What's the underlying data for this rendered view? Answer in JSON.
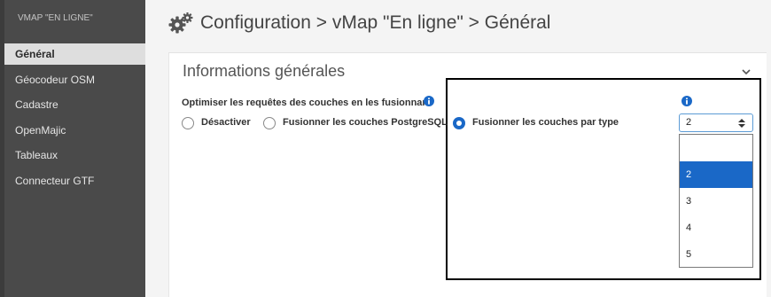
{
  "sidebar": {
    "brand": "VMAP \"EN LIGNE\"",
    "items": [
      {
        "label": "Général",
        "active": true
      },
      {
        "label": "Géocodeur OSM"
      },
      {
        "label": "Cadastre"
      },
      {
        "label": "OpenMajic"
      },
      {
        "label": "Tableaux"
      },
      {
        "label": "Connecteur GTF"
      }
    ]
  },
  "header": {
    "icon": "gears-icon",
    "title": "Configuration > vMap \"En ligne\" > Général"
  },
  "panel": {
    "title": "Informations générales",
    "collapse_icon": "chevron-down-icon"
  },
  "merge_setting": {
    "question": "Optimiser les requêtes des couches en les fusionnant",
    "options": [
      {
        "label": "Désactiver",
        "checked": false
      },
      {
        "label": "Fusionner les couches PostgreSQL",
        "checked": false
      },
      {
        "label": "Fusionner les couches par type",
        "checked": true
      }
    ]
  },
  "type_count_select": {
    "value": "2",
    "options": [
      "",
      "2",
      "3",
      "4",
      "5"
    ],
    "highlighted": "2"
  },
  "colors": {
    "accent": "#1a68c7",
    "sidebar_bg": "#4a4a4a",
    "active_item_bg": "#dedede"
  }
}
